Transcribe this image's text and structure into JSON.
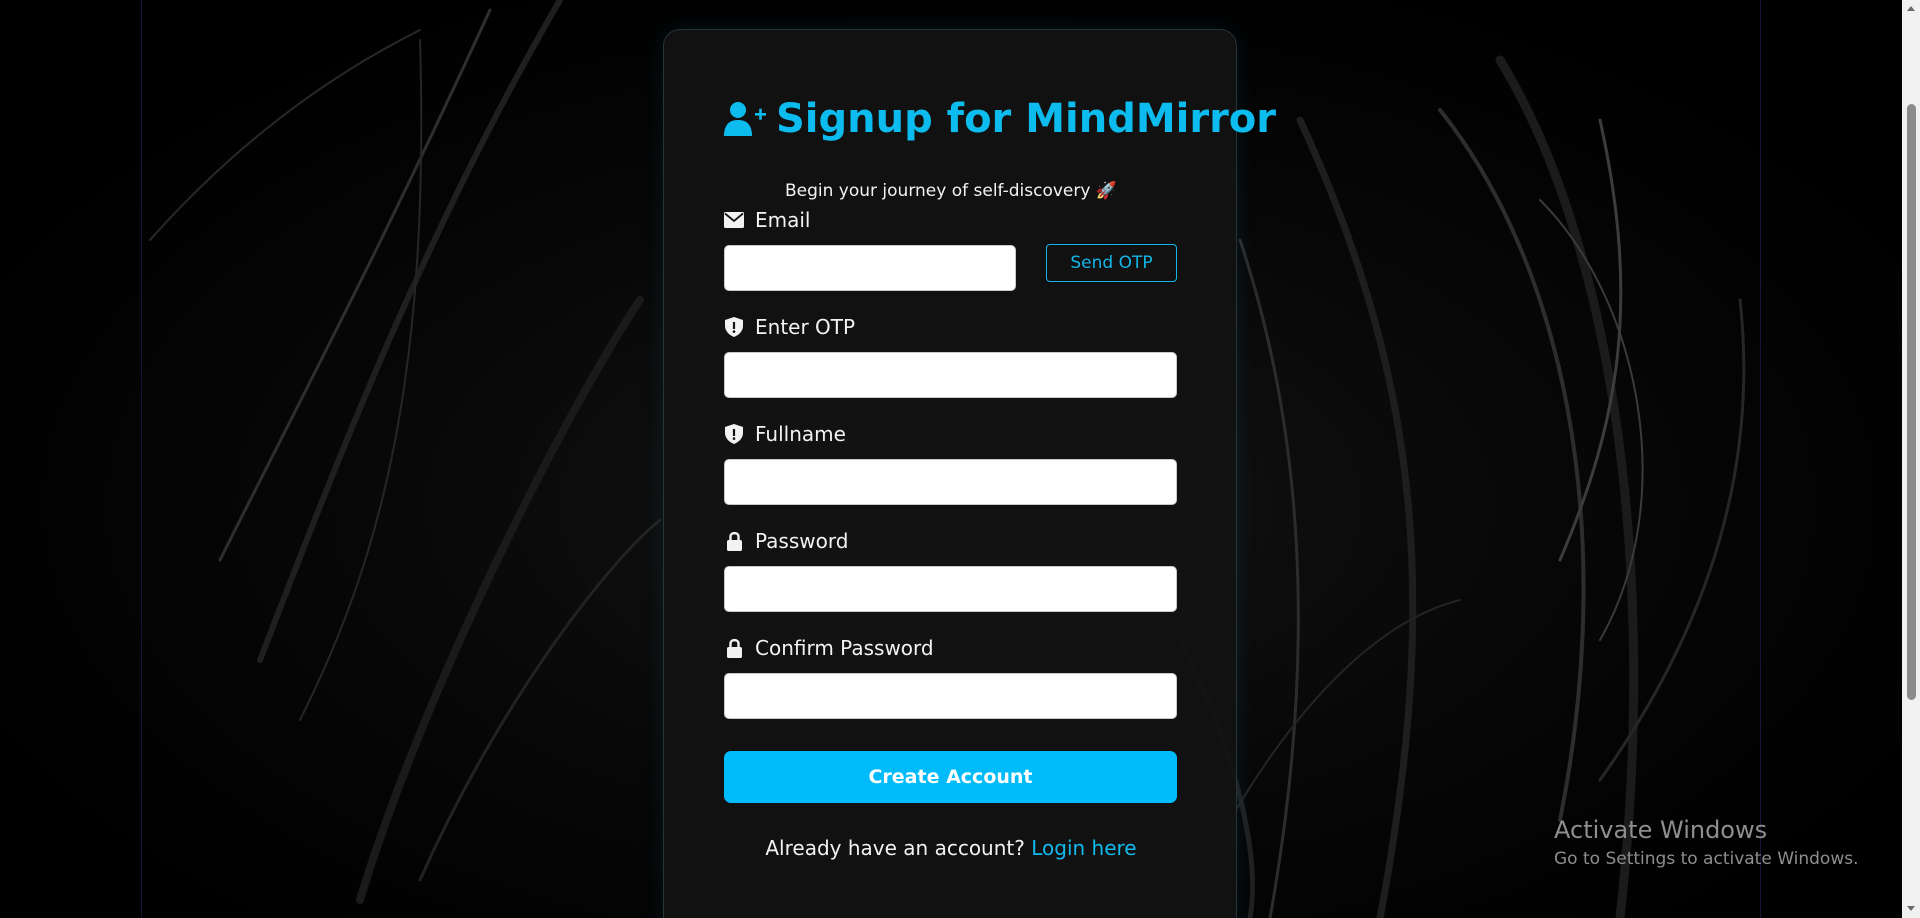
{
  "signup": {
    "title": "Signup for MindMirror",
    "subtitle": "Begin your journey of self-discovery 🚀",
    "accent_color": "#0dbcee",
    "fields": {
      "email": {
        "label": "Email",
        "icon": "envelope-icon",
        "value": "",
        "placeholder": ""
      },
      "otp": {
        "label": "Enter OTP",
        "icon": "shield-icon",
        "value": "",
        "placeholder": ""
      },
      "fullname": {
        "label": "Fullname",
        "icon": "shield-icon",
        "value": "",
        "placeholder": ""
      },
      "password": {
        "label": "Password",
        "icon": "lock-icon",
        "value": "",
        "placeholder": ""
      },
      "confirm_password": {
        "label": "Confirm Password",
        "icon": "lock-icon",
        "value": "",
        "placeholder": ""
      }
    },
    "send_otp_label": "Send OTP",
    "create_account_label": "Create Account",
    "login_prompt": "Already have an account?",
    "login_link": "Login here"
  },
  "watermark": {
    "line1": "Activate Windows",
    "line2": "Go to Settings to activate Windows."
  }
}
